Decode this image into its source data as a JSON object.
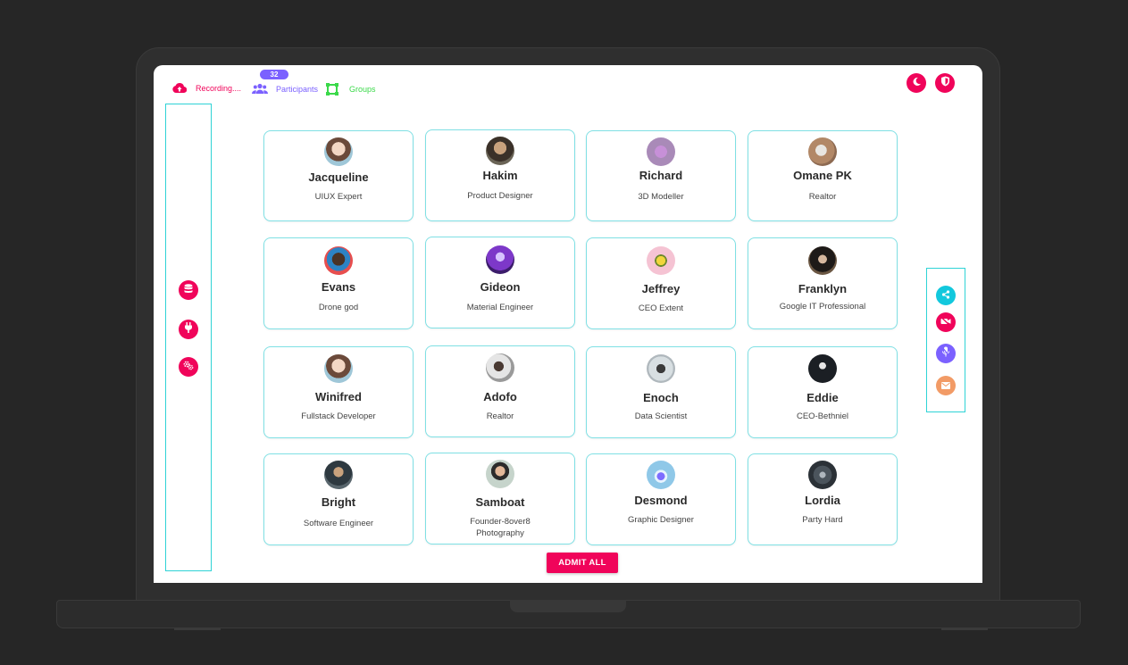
{
  "topbar": {
    "recording_label": "Recording....",
    "participants_label": "Participants",
    "participants_count": "32",
    "groups_label": "Groups"
  },
  "colors": {
    "accent": "#f0045a",
    "purple": "#7b61ff",
    "cyan": "#12c8dd",
    "green": "#3bd94a",
    "orange": "#f29b66",
    "border": "#2fd3d6"
  },
  "icons": {
    "recording": "cloud-upload-icon",
    "participants": "users-icon",
    "groups": "groups-square-icon",
    "theme": "moon-icon",
    "security": "shield-icon",
    "left_tools": [
      "database-icon",
      "plug-icon",
      "settings-cog-icon"
    ],
    "right_tools": [
      "share-icon",
      "video-off-icon",
      "mic-off-icon",
      "chat-icon"
    ]
  },
  "participants": [
    {
      "name": "Jacqueline",
      "role": "UIUX Expert"
    },
    {
      "name": "Hakim",
      "role": "Product Designer"
    },
    {
      "name": "Richard",
      "role": "3D Modeller"
    },
    {
      "name": "Omane PK",
      "role": "Realtor"
    },
    {
      "name": "Evans",
      "role": "Drone god"
    },
    {
      "name": "Gideon",
      "role": "Material Engineer"
    },
    {
      "name": "Jeffrey",
      "role": "CEO Extent"
    },
    {
      "name": "Franklyn",
      "role": "Google IT Professional"
    },
    {
      "name": "Winifred",
      "role": "Fullstack Developer"
    },
    {
      "name": "Adofo",
      "role": "Realtor"
    },
    {
      "name": "Enoch",
      "role": "Data Scientist"
    },
    {
      "name": "Eddie",
      "role": "CEO-Bethniel"
    },
    {
      "name": "Bright",
      "role": "Software Engineer"
    },
    {
      "name": "Samboat",
      "role": "Founder-8over8 Photography"
    },
    {
      "name": "Desmond",
      "role": "Graphic Designer"
    },
    {
      "name": "Lordia",
      "role": "Party Hard"
    }
  ],
  "admit_label": "ADMIT ALL"
}
